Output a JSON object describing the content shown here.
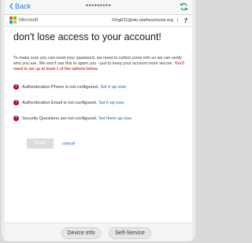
{
  "nav": {
    "back_label": "Back",
    "title": "*********"
  },
  "app_header": {
    "brand": "Microsoft",
    "user_email": "02rg021@stu.olatheschools.org",
    "help_label": "?"
  },
  "main": {
    "heading": "don't lose access to your account!",
    "description": "To make sure you can reset your password, we need to collect some info so we can verify who you are. We won't use this to spam you - just to keep your account more secure.",
    "warning": "You'll need to set up at least 1 of the options below.",
    "items": [
      {
        "text": "Authentication Phone is not configured.",
        "link": "Set it up now"
      },
      {
        "text": "Authentication Email is not configured.",
        "link": "Set it up now"
      },
      {
        "text": "Security Questions are not configured.",
        "link": "Set them up now"
      }
    ],
    "finish_label": "finish",
    "cancel_label": "cancel"
  },
  "bottom": {
    "device_info_label": "Device Info",
    "self_service_label": "Self-Service"
  },
  "colors": {
    "link": "#1a5fb4",
    "error_icon": "#b4005a",
    "warning_text": "#c00000",
    "refresh_icon": "#2e9e5e"
  },
  "icons": {
    "back": "chevron-left-icon",
    "refresh": "refresh-icon",
    "error": "error-circle-icon"
  }
}
